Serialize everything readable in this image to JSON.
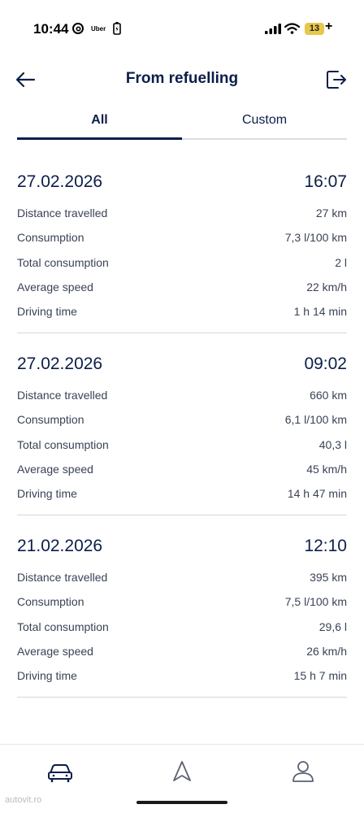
{
  "status_bar": {
    "time": "10:44",
    "uber_label": "Uber",
    "battery": "13"
  },
  "header": {
    "title": "From refuelling"
  },
  "tabs": [
    {
      "label": "All",
      "active": true
    },
    {
      "label": "Custom",
      "active": false
    }
  ],
  "trips": [
    {
      "date": "27.02.2026",
      "time": "16:07",
      "rows": [
        {
          "label": "Distance travelled",
          "value": "27 km"
        },
        {
          "label": "Consumption",
          "value": "7,3 l/100 km"
        },
        {
          "label": "Total consumption",
          "value": "2 l"
        },
        {
          "label": "Average speed",
          "value": "22 km/h"
        },
        {
          "label": "Driving time",
          "value": "1 h 14 min"
        }
      ]
    },
    {
      "date": "27.02.2026",
      "time": "09:02",
      "rows": [
        {
          "label": "Distance travelled",
          "value": "660 km"
        },
        {
          "label": "Consumption",
          "value": "6,1 l/100 km"
        },
        {
          "label": "Total consumption",
          "value": "40,3 l"
        },
        {
          "label": "Average speed",
          "value": "45 km/h"
        },
        {
          "label": "Driving time",
          "value": "14 h 47 min"
        }
      ]
    },
    {
      "date": "21.02.2026",
      "time": "12:10",
      "rows": [
        {
          "label": "Distance travelled",
          "value": "395 km"
        },
        {
          "label": "Consumption",
          "value": "7,5 l/100 km"
        },
        {
          "label": "Total consumption",
          "value": "29,6 l"
        },
        {
          "label": "Average speed",
          "value": "26 km/h"
        },
        {
          "label": "Driving time",
          "value": "15 h 7 min"
        }
      ]
    }
  ],
  "bottom_nav": {
    "items": [
      {
        "icon": "car-icon"
      },
      {
        "icon": "navigation-arrow-icon"
      },
      {
        "icon": "profile-icon"
      }
    ]
  },
  "watermark": "autovit.ro",
  "colors": {
    "primary": "#0b1e4a",
    "text_secondary": "#3a4256",
    "divider": "#d4d6dc",
    "battery": "#e8c84a"
  }
}
